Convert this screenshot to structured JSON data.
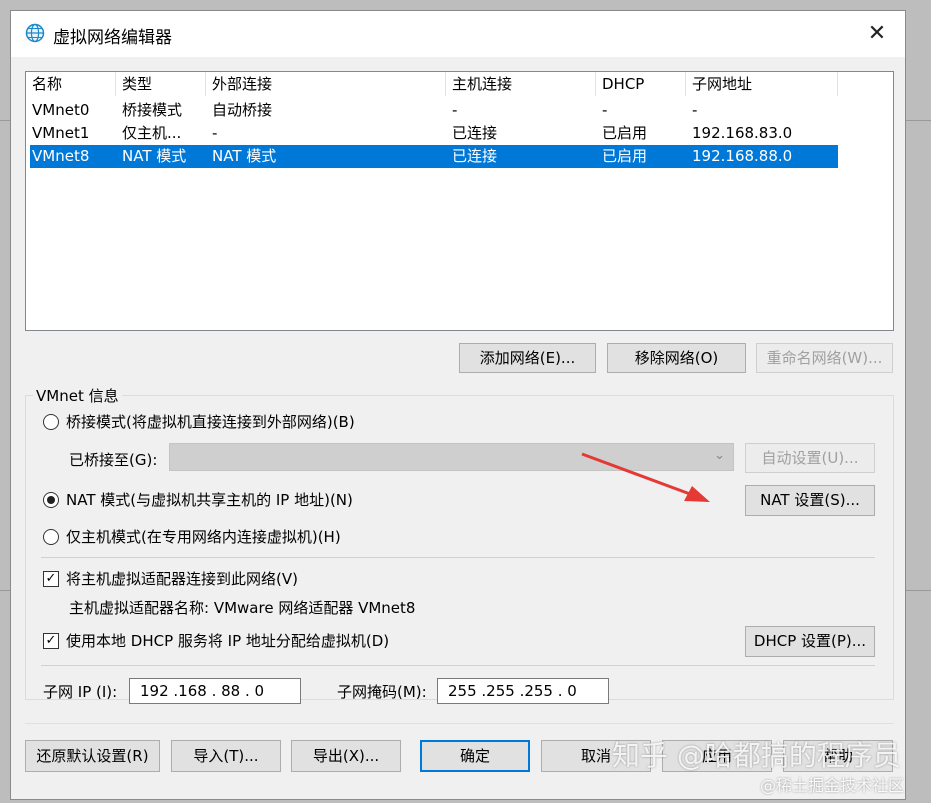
{
  "window": {
    "title": "虚拟网络编辑器",
    "close_symbol": "✕"
  },
  "network_list": {
    "columns": [
      "名称",
      "类型",
      "外部连接",
      "主机连接",
      "DHCP",
      "子网地址"
    ],
    "rows": [
      [
        "VMnet0",
        "桥接模式",
        "自动桥接",
        "-",
        "-",
        "-"
      ],
      [
        "VMnet1",
        "仅主机...",
        "-",
        "已连接",
        "已启用",
        "192.168.83.0"
      ],
      [
        "VMnet8",
        "NAT 模式",
        "NAT 模式",
        "已连接",
        "已启用",
        "192.168.88.0"
      ]
    ],
    "selected_index": 2
  },
  "list_buttons": {
    "add": "添加网络(E)...",
    "remove": "移除网络(O)",
    "rename": "重命名网络(W)..."
  },
  "vmnet_info": {
    "group_label": "VMnet 信息",
    "bridged_label": "桥接模式(将虚拟机直接连接到外部网络)(B)",
    "bridged_to_label": "已桥接至(G):",
    "auto_settings": "自动设置(U)...",
    "nat_label": "NAT 模式(与虚拟机共享主机的 IP 地址)(N)",
    "nat_settings": "NAT 设置(S)...",
    "hostonly_label": "仅主机模式(在专用网络内连接虚拟机)(H)",
    "connect_adapter_label": "将主机虚拟适配器连接到此网络(V)",
    "adapter_name_label": "主机虚拟适配器名称: VMware 网络适配器 VMnet8",
    "dhcp_label": "使用本地 DHCP 服务将 IP 地址分配给虚拟机(D)",
    "dhcp_settings": "DHCP 设置(P)...",
    "selected_mode": "nat",
    "connect_adapter_checked": true,
    "dhcp_checked": true,
    "subnet_ip_label": "子网 IP (I):",
    "subnet_ip": "192 .168 . 88  .  0",
    "subnet_mask_label": "子网掩码(M):",
    "subnet_mask": "255 .255 .255 .  0"
  },
  "footer_buttons": {
    "restore": "还原默认设置(R)",
    "import": "导入(T)...",
    "export": "导出(X)...",
    "ok": "确定",
    "cancel": "取消",
    "apply": "应用",
    "help": "帮助"
  },
  "watermark": {
    "line1": "知乎 @哈都搞的程序员",
    "line2": "@稀土掘金技术社区"
  },
  "colors": {
    "selection": "#0078d7",
    "arrow": "#e53935"
  }
}
